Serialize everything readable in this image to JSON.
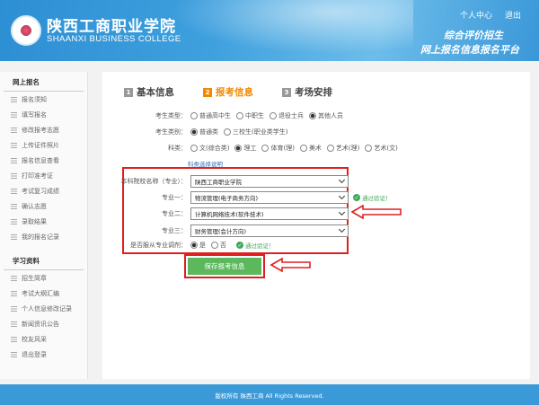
{
  "header": {
    "school_cn": "陕西工商职业学院",
    "school_en": "SHAANXI BUSINESS COLLEGE",
    "link_center": "个人中心",
    "link_logout": "退出",
    "slogan_line1": "综合评价招生",
    "slogan_line2": "网上报名信息报名平台",
    "colors": {
      "header": "#3fa0de",
      "footer": "#3a9ad8",
      "accent": "#f08a00",
      "button": "#5cb85c",
      "highlight": "#e02020"
    }
  },
  "sidebar": {
    "section1": "网上报名",
    "items1": [
      "报名须知",
      "填写报名",
      "修改报考志愿",
      "上传证件照片",
      "报名信息查看",
      "打印准考证",
      "考试复习成绩",
      "确认志愿",
      "录取结果",
      "我的报名记录"
    ],
    "section2": "学习资料",
    "items2": [
      "招生简章",
      "考试大纲汇编",
      "个人信息修改记录",
      "新闻资讯公告",
      "校友风采",
      "退出登录"
    ]
  },
  "steps": [
    {
      "num": "1",
      "label": "基本信息"
    },
    {
      "num": "2",
      "label": "报考信息"
    },
    {
      "num": "3",
      "label": "考场安排"
    }
  ],
  "form": {
    "row1_label": "考生类型：",
    "row1_options": [
      "普通高中生",
      "中职生",
      "退役士兵",
      "其他人员"
    ],
    "row2_label": "考生类别：",
    "row2_options": [
      "普通类",
      "三校生(职业类学生)"
    ],
    "row3_label": "科类：",
    "row3_options": [
      "文(综合类)",
      "理工",
      "体育(理)",
      "美术",
      "艺术(理)",
      "艺术(文)"
    ],
    "link": "科类选择说明",
    "school_label": "本科院校名称（专业）：",
    "school_value": "陕西工商职业学院",
    "major1_label": "专业一：",
    "major1_value": "物流管理(电子商务方向)",
    "verify_text": "通过验证！",
    "major2_label": "专业二：",
    "major2_value": "计算机网络技术(软件技术)",
    "major3_label": "专业三：",
    "major3_value": "财务管理(会计方向)",
    "adjust_label": "是否服从专业调剂：",
    "adjust_options": [
      "是",
      "否"
    ],
    "adjust_verify": "通过验证！",
    "save_label": "保存报考信息"
  },
  "footer": {
    "text": "版权所有 陕西工商 All Rights Reserved."
  }
}
